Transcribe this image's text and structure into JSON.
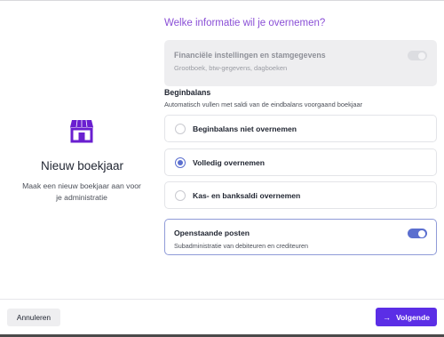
{
  "left": {
    "title": "Nieuw boekjaar",
    "description": "Maak een nieuw boekjaar aan voor je administratie",
    "icon": "store-icon"
  },
  "heading": "Welke informatie wil je overnemen?",
  "financial_card": {
    "title": "Financiële instellingen en stamgegevens",
    "subtitle": "Grootboek, btw-gegevens, dagboeken",
    "toggle_on": true,
    "disabled": true
  },
  "opening_balance": {
    "title": "Beginbalans",
    "subtitle": "Automatisch vullen met saldi van de eindbalans voorgaand boekjaar",
    "options": [
      {
        "label": "Beginbalans niet overnemen",
        "selected": false
      },
      {
        "label": "Volledig overnemen",
        "selected": true
      },
      {
        "label": "Kas- en banksaldi overnemen",
        "selected": false
      }
    ]
  },
  "open_items": {
    "title": "Openstaande posten",
    "subtitle": "Subadministratie van debiteuren en crediteuren",
    "toggle_on": true
  },
  "footer": {
    "cancel_label": "Annuleren",
    "next_label": "Volgende"
  },
  "colors": {
    "accent": "#5b2ee6",
    "heading": "#8a4fd6",
    "toggle": "#5b6fcf",
    "icon": "#6a1fd0"
  }
}
